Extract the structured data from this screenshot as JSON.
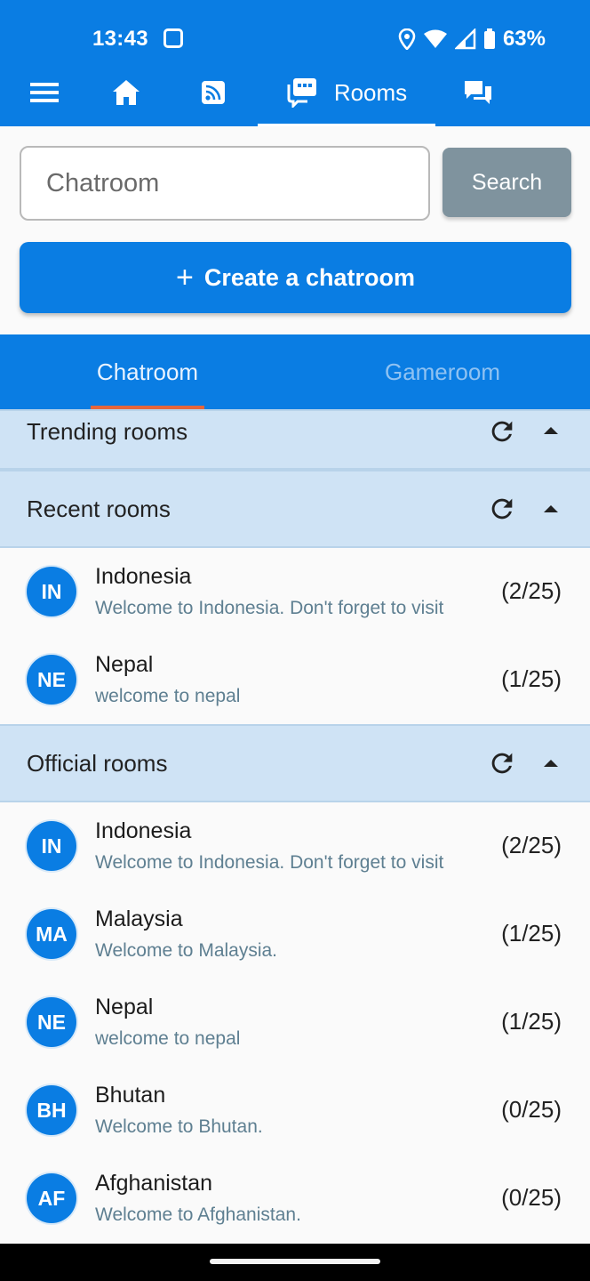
{
  "status_bar": {
    "time": "13:43",
    "battery": "63%"
  },
  "nav": {
    "menu_icon": "menu-icon",
    "home_icon": "home-icon",
    "feed_icon": "rss-icon",
    "rooms_icon": "rooms-icon",
    "rooms_label": "Rooms",
    "messages_icon": "messages-icon"
  },
  "search": {
    "placeholder": "Chatroom",
    "value": "",
    "button_label": "Search"
  },
  "create": {
    "plus": "+",
    "label": "Create a chatroom"
  },
  "tabs": [
    {
      "label": "Chatroom",
      "selected": true
    },
    {
      "label": "Gameroom",
      "selected": false
    }
  ],
  "sections": {
    "trending": {
      "title": "Trending rooms",
      "rooms": []
    },
    "recent": {
      "title": "Recent rooms",
      "rooms": [
        {
          "initials": "IN",
          "name": "Indonesia",
          "description": "Welcome to Indonesia. Don't forget to visit",
          "count": "(2/25)"
        },
        {
          "initials": "NE",
          "name": "Nepal",
          "description": "welcome to nepal",
          "count": "(1/25)"
        }
      ]
    },
    "official": {
      "title": "Official rooms",
      "rooms": [
        {
          "initials": "IN",
          "name": "Indonesia",
          "description": "Welcome to Indonesia. Don't forget to visit",
          "count": "(2/25)"
        },
        {
          "initials": "MA",
          "name": "Malaysia",
          "description": "Welcome to Malaysia.",
          "count": "(1/25)"
        },
        {
          "initials": "NE",
          "name": "Nepal",
          "description": "welcome to nepal",
          "count": "(1/25)"
        },
        {
          "initials": "BH",
          "name": "Bhutan",
          "description": "Welcome to Bhutan.",
          "count": "(0/25)"
        },
        {
          "initials": "AF",
          "name": "Afghanistan",
          "description": "Welcome to Afghanistan.",
          "count": "(0/25)"
        }
      ]
    }
  },
  "colors": {
    "primary": "#0a7de3",
    "section_bg": "#cfe3f5",
    "tab_indicator": "#e5663b",
    "search_button": "#7f939e"
  }
}
